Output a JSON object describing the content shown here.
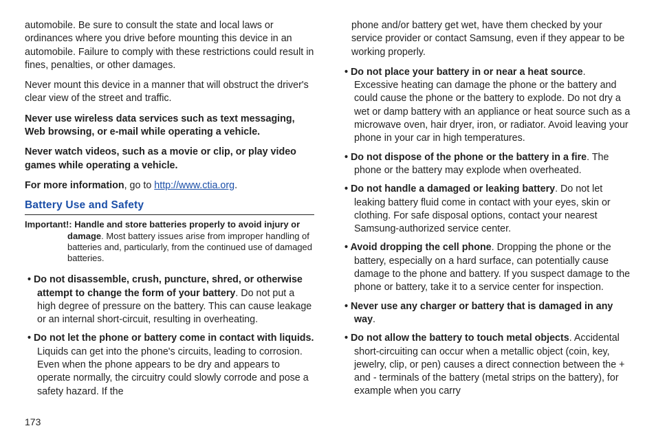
{
  "pageNumber": "173",
  "left": {
    "p1": "automobile. Be sure to consult the state and local laws or ordinances where you drive before mounting this device in an automobile. Failure to comply with these restrictions could result in fines, penalties, or other damages.",
    "p2": "Never mount this device in a manner that will obstruct the driver's clear view of the street and traffic.",
    "p3": "Never use wireless data services such as text messaging, Web browsing, or e-mail while operating a vehicle.",
    "p4": "Never watch videos, such as a movie or clip, or play video games while operating a vehicle.",
    "p5_lead": "For more information",
    "p5_mid": ", go to ",
    "p5_link": "http://www.ctia.org",
    "p5_tail": ".",
    "sectionTitle": "Battery Use and Safety",
    "important_label": "Important!:",
    "important_bold": " Handle and store batteries properly to avoid injury or damage",
    "important_rest": ". Most battery issues arise from improper handling of batteries and, particularly, from the continued use of damaged batteries.",
    "b1_bold": "Do not disassemble, crush, puncture, shred, or otherwise attempt to change the form of your battery",
    "b1_rest": ". Do not put a high degree of pressure on the battery. This can cause leakage or an internal short-circuit, resulting in overheating.",
    "b2_bold": "Do not let the phone or battery come in contact with liquids.",
    "b2_rest": " Liquids can get into the phone's circuits, leading to corrosion. Even when the phone appears to be dry and appears to operate normally, the circuitry could slowly corrode and pose a safety hazard. If the"
  },
  "right": {
    "p1": "phone and/or battery get wet, have them checked by your service provider or contact Samsung, even if they appear to be working properly.",
    "b1_bold": "Do not place your battery in or near a heat source",
    "b1_rest": ". Excessive heating can damage the phone or the battery and could cause the phone or the battery to explode. Do not dry a wet or damp battery with an appliance or heat source such as a microwave oven, hair dryer, iron, or radiator. Avoid leaving your phone in your car in high temperatures.",
    "b2_bold": "Do not dispose of the phone or the battery in a fire",
    "b2_rest": ". The phone or the battery may explode when overheated.",
    "b3_bold": "Do not handle a damaged or leaking battery",
    "b3_rest": ". Do not let leaking battery fluid come in contact with your eyes, skin or clothing. For safe disposal options, contact your nearest Samsung-authorized service center.",
    "b4_bold": "Avoid dropping the cell phone",
    "b4_rest": ". Dropping the phone or the battery, especially on a hard surface, can potentially cause damage to the phone and battery. If you suspect damage to the phone or battery, take it to a service center for inspection.",
    "b5_bold": "Never use any charger or battery that is damaged in any way",
    "b5_rest": ".",
    "b6_bold": "Do not allow the battery to touch metal objects",
    "b6_rest": ". Accidental short-circuiting can occur when a metallic object (coin, key, jewelry, clip, or pen) causes a direct connection between the + and - terminals of the battery (metal strips on the battery), for example when you carry"
  }
}
